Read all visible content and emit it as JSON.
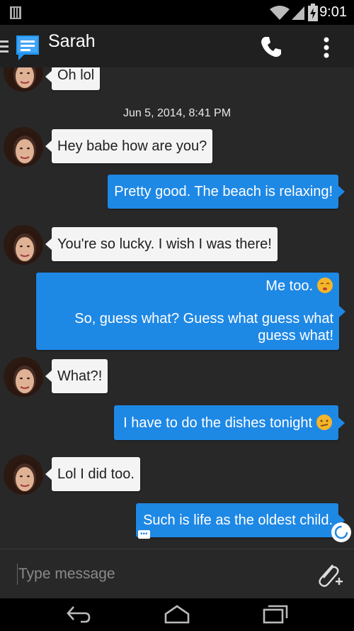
{
  "status_bar": {
    "time": "9:01"
  },
  "app_bar": {
    "title": "Sarah"
  },
  "messages": [
    {
      "direction": "in",
      "text": "Oh lol"
    },
    {
      "type": "timestamp",
      "text": "Jun 5, 2014, 8:41 PM"
    },
    {
      "direction": "in",
      "text": "Hey babe how are you?"
    },
    {
      "direction": "out",
      "text": "Pretty good. The beach is relaxing!"
    },
    {
      "direction": "in",
      "text": "You're so lucky. I wish I was there!"
    },
    {
      "direction": "out",
      "lines": [
        "Me too.",
        "So, guess what? Guess what guess what",
        "guess what!"
      ],
      "emoji": "kissing-face"
    },
    {
      "direction": "in",
      "text": "What?!"
    },
    {
      "direction": "out",
      "text": "I have to do the dishes tonight",
      "emoji": "confused-face"
    },
    {
      "direction": "in",
      "text": "Lol I did too."
    },
    {
      "direction": "out",
      "text": "Such is life as the oldest child.",
      "status": "sending"
    }
  ],
  "compose": {
    "placeholder": "Type message"
  },
  "colors": {
    "outgoing": "#1e88e5",
    "incoming": "#f4f4f4",
    "background": "#282828"
  }
}
